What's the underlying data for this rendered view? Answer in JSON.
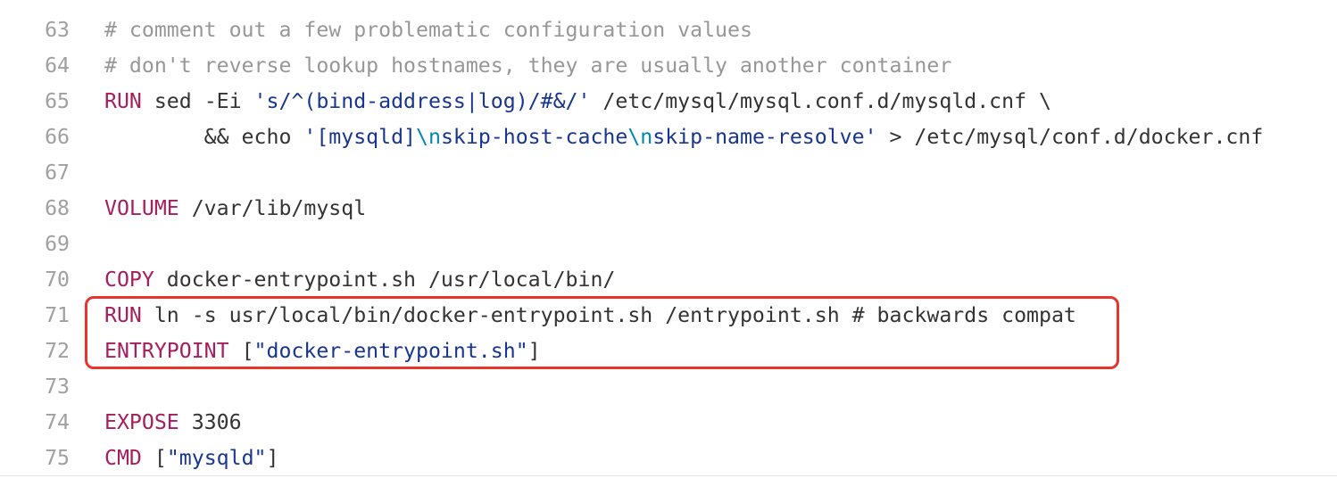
{
  "editor": {
    "highlight_color": "#e8342c",
    "colors": {
      "keyword": "#a71d5d",
      "string": "#183691",
      "escape": "#0086b3",
      "comment": "#969896",
      "plain": "#333333",
      "line_number": "#a0a0a0"
    },
    "highlighted_lines": [
      71,
      72
    ],
    "lines": [
      {
        "number": "63",
        "tokens": [
          {
            "kind": "com",
            "text": "# comment out a few problematic configuration values"
          }
        ]
      },
      {
        "number": "64",
        "tokens": [
          {
            "kind": "com",
            "text": "# don't reverse lookup hostnames, they are usually another container"
          }
        ]
      },
      {
        "number": "65",
        "tokens": [
          {
            "kind": "kw",
            "text": "RUN"
          },
          {
            "kind": "pl",
            "text": " sed -Ei "
          },
          {
            "kind": "str",
            "text": "'s/^(bind-address|log)/#&/'"
          },
          {
            "kind": "pl",
            "text": " /etc/mysql/mysql.conf.d/mysqld.cnf \\"
          }
        ]
      },
      {
        "number": "66",
        "tokens": [
          {
            "kind": "pl",
            "text": "        && echo "
          },
          {
            "kind": "str",
            "text": "'[mysqld]"
          },
          {
            "kind": "esc",
            "text": "\\n"
          },
          {
            "kind": "str",
            "text": "skip-host-cache"
          },
          {
            "kind": "esc",
            "text": "\\n"
          },
          {
            "kind": "str",
            "text": "skip-name-resolve'"
          },
          {
            "kind": "pl",
            "text": " > /etc/mysql/conf.d/docker.cnf"
          }
        ]
      },
      {
        "number": "67",
        "tokens": []
      },
      {
        "number": "68",
        "tokens": [
          {
            "kind": "kw",
            "text": "VOLUME"
          },
          {
            "kind": "pl",
            "text": " /var/lib/mysql"
          }
        ]
      },
      {
        "number": "69",
        "tokens": []
      },
      {
        "number": "70",
        "tokens": [
          {
            "kind": "kw",
            "text": "COPY"
          },
          {
            "kind": "pl",
            "text": " docker-entrypoint.sh /usr/local/bin/"
          }
        ]
      },
      {
        "number": "71",
        "tokens": [
          {
            "kind": "kw",
            "text": "RUN"
          },
          {
            "kind": "pl",
            "text": " ln -s usr/local/bin/docker-entrypoint.sh /entrypoint.sh # backwards compat"
          }
        ]
      },
      {
        "number": "72",
        "tokens": [
          {
            "kind": "kw",
            "text": "ENTRYPOINT"
          },
          {
            "kind": "pl",
            "text": " ["
          },
          {
            "kind": "str",
            "text": "\"docker-entrypoint.sh\""
          },
          {
            "kind": "pl",
            "text": "]"
          }
        ]
      },
      {
        "number": "73",
        "tokens": []
      },
      {
        "number": "74",
        "tokens": [
          {
            "kind": "kw",
            "text": "EXPOSE"
          },
          {
            "kind": "pl",
            "text": " 3306"
          }
        ]
      },
      {
        "number": "75",
        "tokens": [
          {
            "kind": "kw",
            "text": "CMD"
          },
          {
            "kind": "pl",
            "text": " ["
          },
          {
            "kind": "str",
            "text": "\"mysqld\""
          },
          {
            "kind": "pl",
            "text": "]"
          }
        ]
      }
    ]
  }
}
